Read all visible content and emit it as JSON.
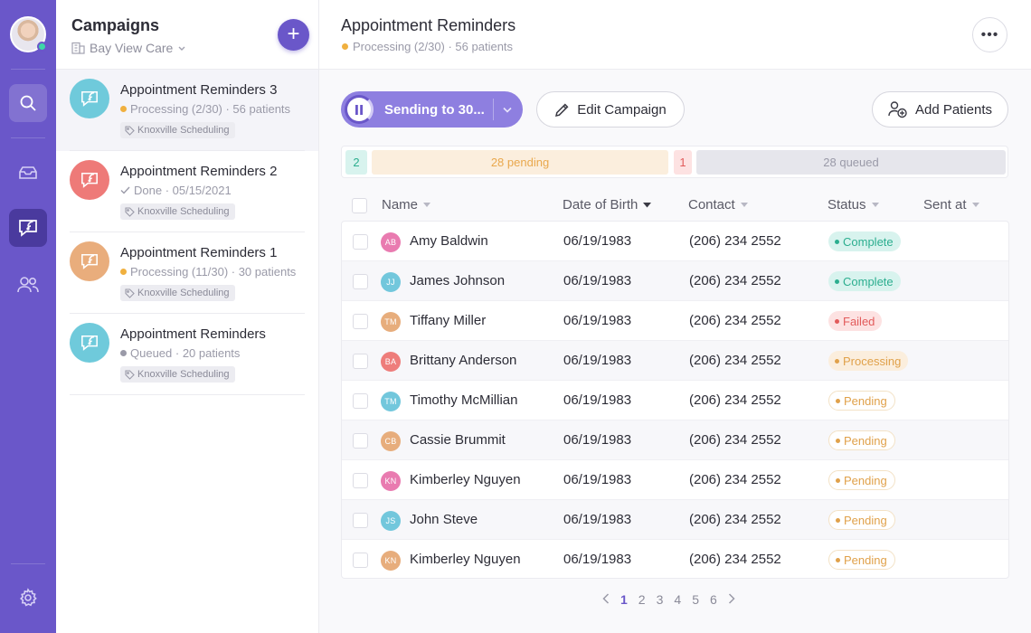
{
  "colors": {
    "brand": "#6a57c9",
    "brand_dark": "#4a3a9e",
    "complete": "#2cae8f",
    "failed": "#e25b5b",
    "pending": "#e0a14a"
  },
  "nav": {
    "icons": [
      "search-icon",
      "inbox-icon",
      "campaigns-icon",
      "contacts-icon",
      "settings-icon"
    ]
  },
  "campaigns_panel": {
    "title": "Campaigns",
    "org": "Bay View Care",
    "items": [
      {
        "name": "Appointment Reminders 3",
        "status": "Processing (2/30) · 56 patients",
        "tag": "Knoxville Scheduling",
        "status_color": "#f0b03f",
        "icon_color": "#6fcadb"
      },
      {
        "name": "Appointment Reminders 2",
        "status": "Done · 05/15/2021",
        "tag": "Knoxville Scheduling",
        "status_color": "#9a9aa8",
        "icon_color": "#ee7a78"
      },
      {
        "name": "Appointment Reminders 1",
        "status": "Processing (11/30) · 30 patients",
        "tag": "Knoxville Scheduling",
        "status_color": "#f0b03f",
        "icon_color": "#e9ad7c"
      },
      {
        "name": "Appointment Reminders",
        "status": "Queued · 20 patients",
        "tag": "Knoxville Scheduling",
        "status_color": "#9a9aa8",
        "icon_color": "#6fcadb"
      }
    ]
  },
  "header": {
    "title": "Appointment Reminders",
    "subtitle": "Processing (2/30) · 56 patients",
    "more": "•••"
  },
  "actions": {
    "send_label": "Sending to 30...",
    "edit_label": "Edit Campaign",
    "add_patients_label": "Add Patients"
  },
  "progress": {
    "complete": "2",
    "pending": "28 pending",
    "failed": "1",
    "queued": "28 queued"
  },
  "table": {
    "columns": [
      "Name",
      "Date of Birth",
      "Contact",
      "Status",
      "Sent at"
    ],
    "rows": [
      {
        "initials": "AB",
        "name": "Amy Baldwin",
        "dob": "06/19/1983",
        "contact": "(206) 234 2552",
        "status": "Complete",
        "avatar": "#e97bb0"
      },
      {
        "initials": "JJ",
        "name": "James Johnson",
        "dob": "06/19/1983",
        "contact": "(206) 234 2552",
        "status": "Complete",
        "avatar": "#72c7dc"
      },
      {
        "initials": "TM",
        "name": "Tiffany Miller",
        "dob": "06/19/1983",
        "contact": "(206) 234 2552",
        "status": "Failed",
        "avatar": "#e7ad7c"
      },
      {
        "initials": "BA",
        "name": "Brittany Anderson",
        "dob": "06/19/1983",
        "contact": "(206) 234 2552",
        "status": "Processing",
        "avatar": "#ee7d7b"
      },
      {
        "initials": "TM",
        "name": "Timothy McMillian",
        "dob": "06/19/1983",
        "contact": "(206) 234 2552",
        "status": "Pending",
        "avatar": "#72c7dc"
      },
      {
        "initials": "CB",
        "name": "Cassie Brummit",
        "dob": "06/19/1983",
        "contact": "(206) 234 2552",
        "status": "Pending",
        "avatar": "#e7ad7c"
      },
      {
        "initials": "KN",
        "name": "Kimberley Nguyen",
        "dob": "06/19/1983",
        "contact": "(206) 234 2552",
        "status": "Pending",
        "avatar": "#e97bb0"
      },
      {
        "initials": "JS",
        "name": "John Steve",
        "dob": "06/19/1983",
        "contact": "(206) 234 2552",
        "status": "Pending",
        "avatar": "#72c7dc"
      },
      {
        "initials": "KN",
        "name": "Kimberley Nguyen",
        "dob": "06/19/1983",
        "contact": "(206) 234 2552",
        "status": "Pending",
        "avatar": "#e7ad7c"
      }
    ]
  },
  "pagination": {
    "pages": [
      "1",
      "2",
      "3",
      "4",
      "5",
      "6"
    ],
    "current": "1"
  }
}
